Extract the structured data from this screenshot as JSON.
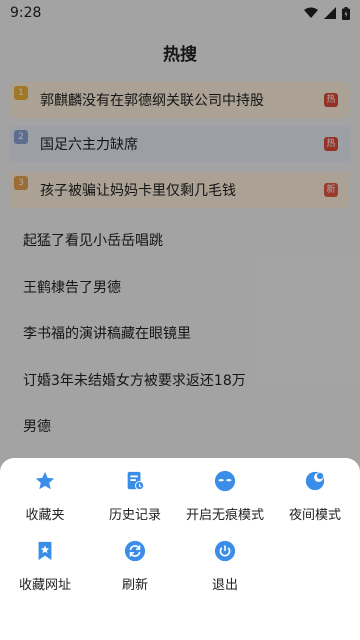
{
  "status": {
    "time": "9:28"
  },
  "page": {
    "title": "热搜"
  },
  "hot_items": [
    {
      "rank": "1",
      "text": "郭麒麟没有在郭德纲关联公司中持股",
      "badge": "热",
      "bg": "#fff1dd",
      "rank_color": "#f0b23d",
      "badge_color": "#e04a3a"
    },
    {
      "rank": "2",
      "text": "国足六主力缺席",
      "badge": "热",
      "bg": "#e9eef8",
      "rank_color": "#8aa3d6",
      "badge_color": "#e04a3a"
    },
    {
      "rank": "3",
      "text": "孩子被骗让妈妈卡里仅剩几毛钱",
      "badge": "新",
      "bg": "#fff1dd",
      "rank_color": "#e7a24c",
      "badge_color": "#e55a46"
    }
  ],
  "plain_items": [
    "起猛了看见小岳岳唱跳",
    "王鹤棣告了男德",
    "李书福的演讲稿藏在眼镜里",
    "订婚3年未结婚女方被要求返还18万",
    "男德"
  ],
  "menu": {
    "items": [
      {
        "label": "收藏夹",
        "icon": "star-icon"
      },
      {
        "label": "历史记录",
        "icon": "history-icon"
      },
      {
        "label": "开启无痕模式",
        "icon": "incognito-icon"
      },
      {
        "label": "夜间模式",
        "icon": "night-mode-icon"
      },
      {
        "label": "收藏网址",
        "icon": "bookmark-icon"
      },
      {
        "label": "刷新",
        "icon": "refresh-icon"
      },
      {
        "label": "退出",
        "icon": "power-icon"
      }
    ]
  },
  "colors": {
    "accent": "#3b8ee8"
  }
}
